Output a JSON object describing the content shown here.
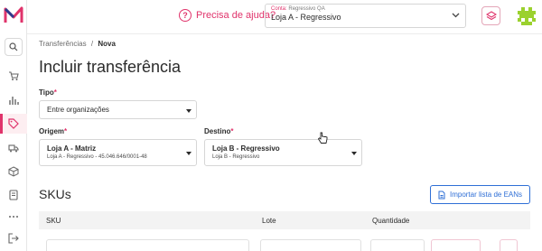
{
  "header": {
    "help_label": "Precisa de ajuda?",
    "account_prefix": "Conta:",
    "account_name": "Regressivo QA",
    "store_value": "Loja A - Regressivo"
  },
  "breadcrumb": {
    "parent": "Transferências",
    "separator": "/",
    "current": "Nova"
  },
  "page_title": "Incluir transferência",
  "form": {
    "tipo_label": "Tipo",
    "tipo_value": "Entre organizações",
    "origem_label": "Origem",
    "origem_title": "Loja A - Matriz",
    "origem_sub": "Loja A - Regressivo - 45.046.646/0001-48",
    "destino_label": "Destino",
    "destino_title": "Loja B - Regressivo",
    "destino_sub": "Loja B - Regressivo",
    "required_mark": "*"
  },
  "skus": {
    "title": "SKUs",
    "import_label": "Importar lista de EANs",
    "columns": [
      "SKU",
      "Lote",
      "Quantidade"
    ]
  },
  "colors": {
    "accent": "#e0336b",
    "link": "#2f6fd6"
  }
}
